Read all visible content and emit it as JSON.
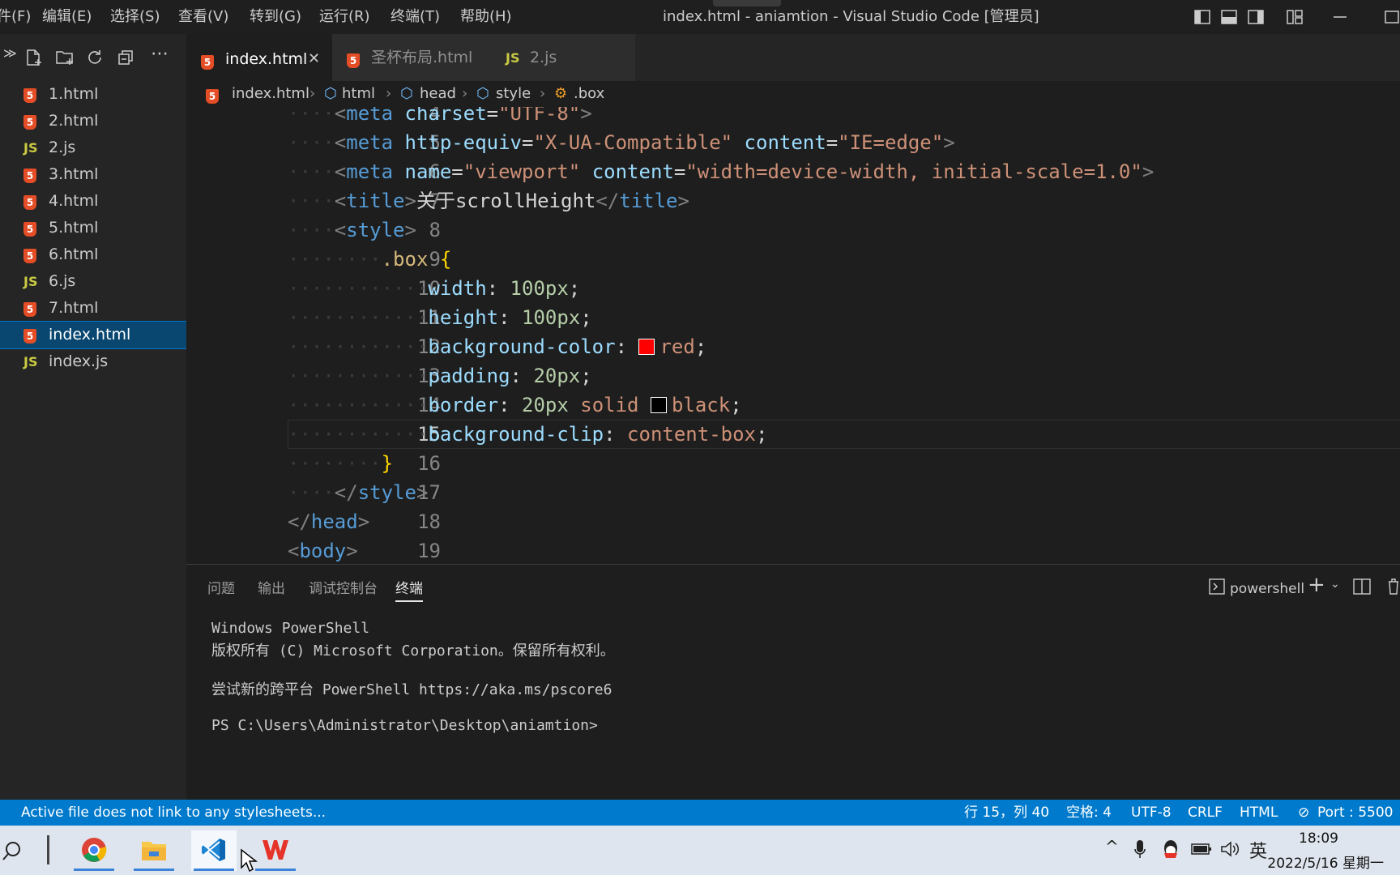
{
  "menu": [
    "件(F)",
    "编辑(E)",
    "选择(S)",
    "查看(V)",
    "转到(G)",
    "运行(R)",
    "终端(T)",
    "帮助(H)"
  ],
  "window_title": "index.html - aniamtion - Visual Studio Code [管理员]",
  "sidebar": {
    "files": [
      {
        "name": "1.html",
        "type": "html"
      },
      {
        "name": "2.html",
        "type": "html"
      },
      {
        "name": "2.js",
        "type": "js"
      },
      {
        "name": "3.html",
        "type": "html"
      },
      {
        "name": "4.html",
        "type": "html"
      },
      {
        "name": "5.html",
        "type": "html"
      },
      {
        "name": "6.html",
        "type": "html"
      },
      {
        "name": "6.js",
        "type": "js"
      },
      {
        "name": "7.html",
        "type": "html"
      },
      {
        "name": "index.html",
        "type": "html",
        "selected": true
      },
      {
        "name": "index.js",
        "type": "js"
      }
    ]
  },
  "tabs": [
    {
      "label": "index.html",
      "active": true,
      "icon": "html5-icon"
    },
    {
      "label": "圣杯布局.html",
      "active": false,
      "icon": "html5-icon"
    },
    {
      "label": "2.js",
      "active": false,
      "icon": "js-icon"
    }
  ],
  "js_icon_label": "JS",
  "html_icon_label": "5",
  "breadcrumb": [
    "index.html",
    "html",
    "head",
    "style",
    ".box"
  ],
  "editor": {
    "current_line": 15,
    "lines": [
      {
        "n": "4",
        "indent": 2,
        "tokens": [
          [
            "tg",
            "<"
          ],
          [
            "tn",
            "meta"
          ],
          [
            "tx",
            " "
          ],
          [
            "at",
            "charset"
          ],
          [
            "tx",
            "="
          ],
          [
            "st",
            "\"UTF-8\""
          ],
          [
            "tg",
            ">"
          ]
        ]
      },
      {
        "n": "5",
        "indent": 2,
        "tokens": [
          [
            "tg",
            "<"
          ],
          [
            "tn",
            "meta"
          ],
          [
            "tx",
            " "
          ],
          [
            "at",
            "http-equiv"
          ],
          [
            "tx",
            "="
          ],
          [
            "st",
            "\"X-UA-Compatible\""
          ],
          [
            "tx",
            " "
          ],
          [
            "at",
            "content"
          ],
          [
            "tx",
            "="
          ],
          [
            "st",
            "\"IE=edge\""
          ],
          [
            "tg",
            ">"
          ]
        ]
      },
      {
        "n": "6",
        "indent": 2,
        "tokens": [
          [
            "tg",
            "<"
          ],
          [
            "tn",
            "meta"
          ],
          [
            "tx",
            " "
          ],
          [
            "at",
            "name"
          ],
          [
            "tx",
            "="
          ],
          [
            "st",
            "\"viewport\""
          ],
          [
            "tx",
            " "
          ],
          [
            "at",
            "content"
          ],
          [
            "tx",
            "="
          ],
          [
            "st",
            "\"width=device-width, initial-scale=1.0\""
          ],
          [
            "tg",
            ">"
          ]
        ]
      },
      {
        "n": "7",
        "indent": 2,
        "tokens": [
          [
            "tg",
            "<"
          ],
          [
            "tn",
            "title"
          ],
          [
            "tg",
            ">"
          ],
          [
            "tx",
            "关于scrollHeight"
          ],
          [
            "tg",
            "</"
          ],
          [
            "tn",
            "title"
          ],
          [
            "tg",
            ">"
          ]
        ]
      },
      {
        "n": "8",
        "indent": 2,
        "tokens": [
          [
            "tg",
            "<"
          ],
          [
            "tn",
            "style"
          ],
          [
            "tg",
            ">"
          ]
        ]
      },
      {
        "n": "9",
        "indent": 4,
        "tokens": [
          [
            "sel",
            ".box"
          ],
          [
            "tx",
            " "
          ],
          [
            "br",
            "{"
          ]
        ]
      },
      {
        "n": "10",
        "indent": 6,
        "tokens": [
          [
            "pr",
            "width"
          ],
          [
            "tx",
            ": "
          ],
          [
            "nm",
            "100px"
          ],
          [
            "tx",
            ";"
          ]
        ]
      },
      {
        "n": "11",
        "indent": 6,
        "tokens": [
          [
            "pr",
            "height"
          ],
          [
            "tx",
            ": "
          ],
          [
            "nm",
            "100px"
          ],
          [
            "tx",
            ";"
          ]
        ]
      },
      {
        "n": "12",
        "indent": 6,
        "tokens": [
          [
            "pr",
            "background-color"
          ],
          [
            "tx",
            ": "
          ],
          [
            "swatch",
            "#ff0000"
          ],
          [
            "vl",
            "red"
          ],
          [
            "tx",
            ";"
          ]
        ]
      },
      {
        "n": "13",
        "indent": 6,
        "tokens": [
          [
            "pr",
            "padding"
          ],
          [
            "tx",
            ": "
          ],
          [
            "nm",
            "20px"
          ],
          [
            "tx",
            ";"
          ]
        ]
      },
      {
        "n": "14",
        "indent": 6,
        "tokens": [
          [
            "pr",
            "border"
          ],
          [
            "tx",
            ": "
          ],
          [
            "nm",
            "20px"
          ],
          [
            "tx",
            " "
          ],
          [
            "vl",
            "solid"
          ],
          [
            "tx",
            " "
          ],
          [
            "swatch",
            "#000000"
          ],
          [
            "vl",
            "black"
          ],
          [
            "tx",
            ";"
          ]
        ]
      },
      {
        "n": "15",
        "indent": 6,
        "tokens": [
          [
            "pr",
            "background-clip"
          ],
          [
            "tx",
            ": "
          ],
          [
            "vl",
            "content-box"
          ],
          [
            "tx",
            ";"
          ]
        ]
      },
      {
        "n": "16",
        "indent": 4,
        "tokens": [
          [
            "br",
            "}"
          ]
        ]
      },
      {
        "n": "17",
        "indent": 2,
        "tokens": [
          [
            "tg",
            "</"
          ],
          [
            "tn",
            "style"
          ],
          [
            "tg",
            ">"
          ]
        ]
      },
      {
        "n": "18",
        "indent": 0,
        "tokens": [
          [
            "tg",
            "</"
          ],
          [
            "tn",
            "head"
          ],
          [
            "tg",
            ">"
          ]
        ]
      },
      {
        "n": "19",
        "indent": 0,
        "tokens": [
          [
            "tg",
            "<"
          ],
          [
            "tn",
            "body"
          ],
          [
            "tg",
            ">"
          ]
        ]
      }
    ]
  },
  "panel": {
    "tabs": [
      "问题",
      "输出",
      "调试控制台",
      "终端"
    ],
    "active_tab": "终端",
    "shell": "powershell",
    "terminal_lines": [
      "Windows PowerShell",
      "版权所有 (C) Microsoft Corporation。保留所有权利。",
      "",
      "尝试新的跨平台 PowerShell https://aka.ms/pscore6",
      "",
      "PS C:\\Users\\Administrator\\Desktop\\aniamtion>"
    ]
  },
  "status": {
    "message": "Active file does not link to any stylesheets...",
    "cursor": "行 15，列 40",
    "spaces": "空格: 4",
    "encoding": "UTF-8",
    "eol": "CRLF",
    "language": "HTML",
    "port": "Port : 5500"
  },
  "taskbar": {
    "time": "18:09",
    "date": "2022/5/16 星期一",
    "ime": "英"
  },
  "colors": {
    "accent": "#007acc",
    "selection": "#094771",
    "html_icon": "#e44d26",
    "js_icon": "#cbcb41"
  }
}
